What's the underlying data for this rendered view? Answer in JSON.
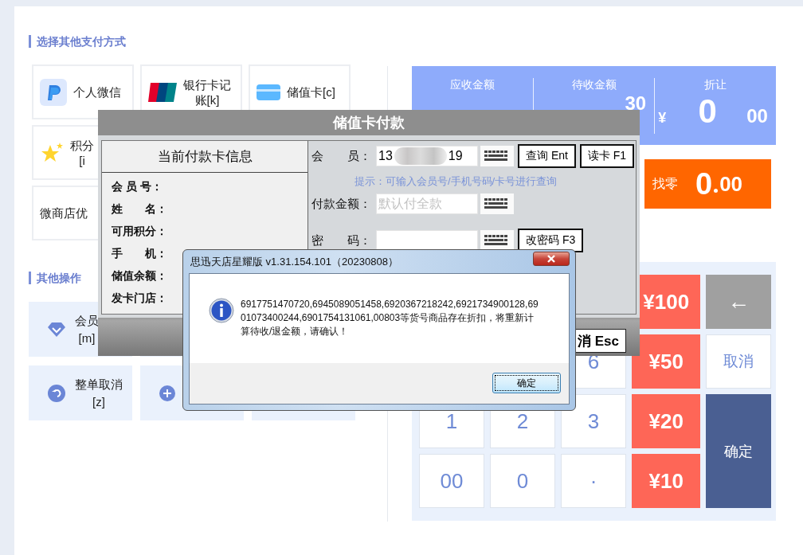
{
  "payment_section": {
    "title": "选择其他支付方式",
    "methods": [
      {
        "kind": "wallet",
        "lines": [
          "个人微信"
        ]
      },
      {
        "kind": "unionpay",
        "lines": [
          "银行卡记",
          "账[k]"
        ]
      },
      {
        "kind": "card",
        "lines": [
          "储值卡[c]"
        ]
      },
      {
        "kind": "star",
        "lines": [
          "积分",
          "[i"
        ]
      },
      {
        "kind": "text",
        "lines": [
          "微商店优"
        ]
      }
    ]
  },
  "operations": {
    "title": "其他操作",
    "items": [
      {
        "kind": "diamond",
        "lines": [
          "会员",
          "[m]"
        ]
      },
      {
        "kind": "blank"
      },
      {
        "kind": "undo",
        "lines": [
          "整单取消",
          "[z]"
        ]
      },
      {
        "kind": "plus"
      },
      {
        "kind": "blank"
      }
    ]
  },
  "summary": [
    {
      "label": "应收金额"
    },
    {
      "label": "待收金额",
      "decimals": "30"
    },
    {
      "label": "折让",
      "currency": "¥",
      "integer": "0",
      "decimals": "00"
    }
  ],
  "change": {
    "label": "找零",
    "integer": "0",
    "decimals": "00"
  },
  "keypad": {
    "digits": [
      "6",
      "1",
      "2",
      "3",
      "00",
      "0",
      "·"
    ],
    "cash": [
      "¥100",
      "¥50",
      "¥20",
      "¥10"
    ],
    "actions": [
      {
        "kind": "back",
        "label": "←"
      },
      {
        "kind": "cancel",
        "label": "取消"
      },
      {
        "kind": "confirm",
        "label": "确定"
      }
    ]
  },
  "card_dialog": {
    "title": "储值卡付款",
    "info_title": "当前付款卡信息",
    "info_fields": [
      "会 员 号：",
      "姓　　名：",
      "可用积分：",
      "手　　机：",
      "储值余额：",
      "发卡门店："
    ],
    "member": {
      "label": "会　　员：",
      "value_start": "13",
      "value_end": "19"
    },
    "query_button": "查询 Ent",
    "read_button": "读卡 F1",
    "hint": "提示：可输入会员号/手机号码/卡号进行查询",
    "amount": {
      "label": "付款金额：",
      "placeholder": "默认付全款"
    },
    "password": {
      "label": "密　　码："
    },
    "change_password_button": "改密码 F3",
    "cancel_button": "消 Esc"
  },
  "message_box": {
    "title": "思迅天店星耀版 v1.31.154.101（20230808）",
    "message": "6917751470720,6945089051458,6920367218242,6921734900128,6901073400244,6901754131061,00803等货号商品存在折扣，将重新计算待收/退金额，请确认！",
    "ok_button": "确定"
  }
}
